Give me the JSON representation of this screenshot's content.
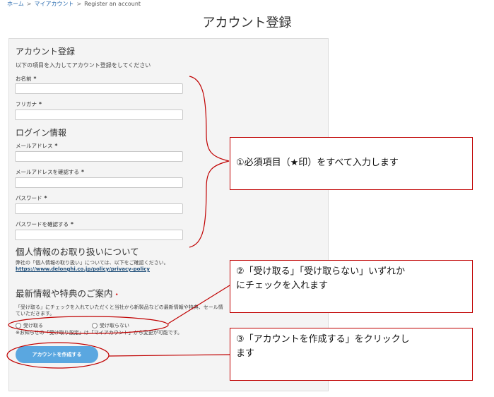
{
  "breadcrumb": {
    "home": "ホーム",
    "my_account": "マイアカウント",
    "current": "Register an account",
    "separator": ">"
  },
  "page_title": "アカウント登録",
  "form": {
    "account_heading": "アカウント登録",
    "account_subtext": "以下の項目を入力してアカウント登録をしてください",
    "name_label": "お名前",
    "furigana_label": "フリガナ",
    "required_mark": "*",
    "login_heading": "ログイン情報",
    "email_label": "メールアドレス",
    "email_confirm_label": "メールアドレスを確認する",
    "password_label": "パスワード",
    "password_confirm_label": "パスワードを確認する",
    "privacy_heading": "個人情報のお取り扱いについて",
    "privacy_text": "弊社の「個人情報の取り扱い」については、以下をご確認ください。",
    "privacy_url": "https://www.delonghi.co.jp/policy/privacy-policy",
    "news_heading": "最新情報や特典のご案内",
    "news_required_dot": "•",
    "news_text_line1": "「受け取る」にチェックを入れていただくと当社から新製品などの最新情報や特典、セール情",
    "news_text_line2": "ていただきます。",
    "radio_receive": "受け取る",
    "radio_not_receive": "受け取らない",
    "news_note": "※お知らせの「受け取り設定」は「マイアカウント」から変更が可能です。",
    "create_button": "アカウントを作成する"
  },
  "callouts": {
    "one": "①必須項目（★印）をすべて入力します",
    "two_line1": "②「受け取る」「受け取らない」いずれか",
    "two_line2": "にチェックを入れます",
    "three_line1": "③「アカウントを作成する」をクリックし",
    "three_line2": "ます"
  },
  "colors": {
    "callout_border": "#c00000",
    "button": "#5aa7e0",
    "panel": "#f4f4f4"
  }
}
